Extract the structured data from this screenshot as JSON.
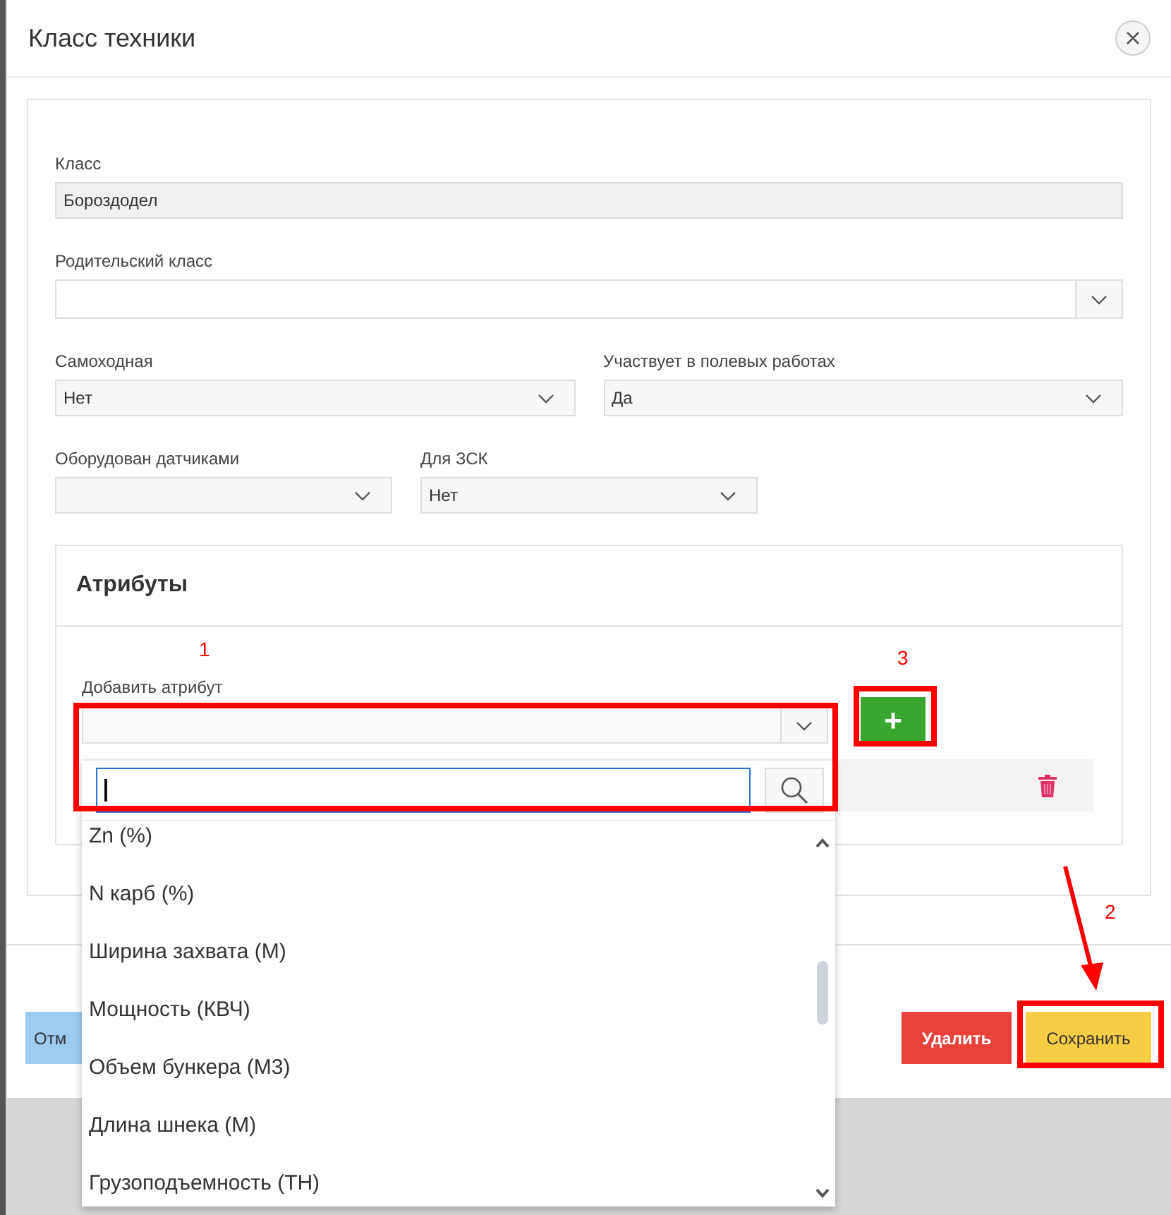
{
  "dialog": {
    "title": "Класс техники"
  },
  "rows": [
    [
      {
        "label": "Класс",
        "value": "Бороздодел",
        "kind": "text"
      }
    ],
    [
      {
        "label": "Родительский класс",
        "kind": "combo"
      }
    ],
    [
      {
        "label": "Самоходная",
        "value": "Нет",
        "kind": "select"
      },
      {
        "label": "Участвует в полевых работах",
        "value": "Да",
        "kind": "select"
      }
    ],
    [
      {
        "label": "Оборудован датчиками",
        "kind": "select"
      },
      {
        "label": "Для ЗСК",
        "value": "Нет",
        "kind": "select"
      }
    ]
  ],
  "attributes": {
    "title": "Атрибуты",
    "add_label": "Добавить атрибут",
    "add_button": "+",
    "dropdown": {
      "options": [
        "Zn (%)",
        "N карб (%)",
        "Ширина захвата (М)",
        "Мощность (КВЧ)",
        "Объем бункера (М3)",
        "Длина шнека (М)",
        "Грузоподъемность (ТН)"
      ]
    }
  },
  "footer": {
    "buttons": [
      {
        "label": "Отм",
        "kind": "cancel"
      },
      {
        "label": "Удалить",
        "kind": "delete"
      },
      {
        "label": "Сохранить",
        "kind": "save"
      }
    ]
  },
  "annotations": [
    {
      "label": "1"
    },
    {
      "label": "3"
    },
    {
      "label": "2"
    }
  ]
}
